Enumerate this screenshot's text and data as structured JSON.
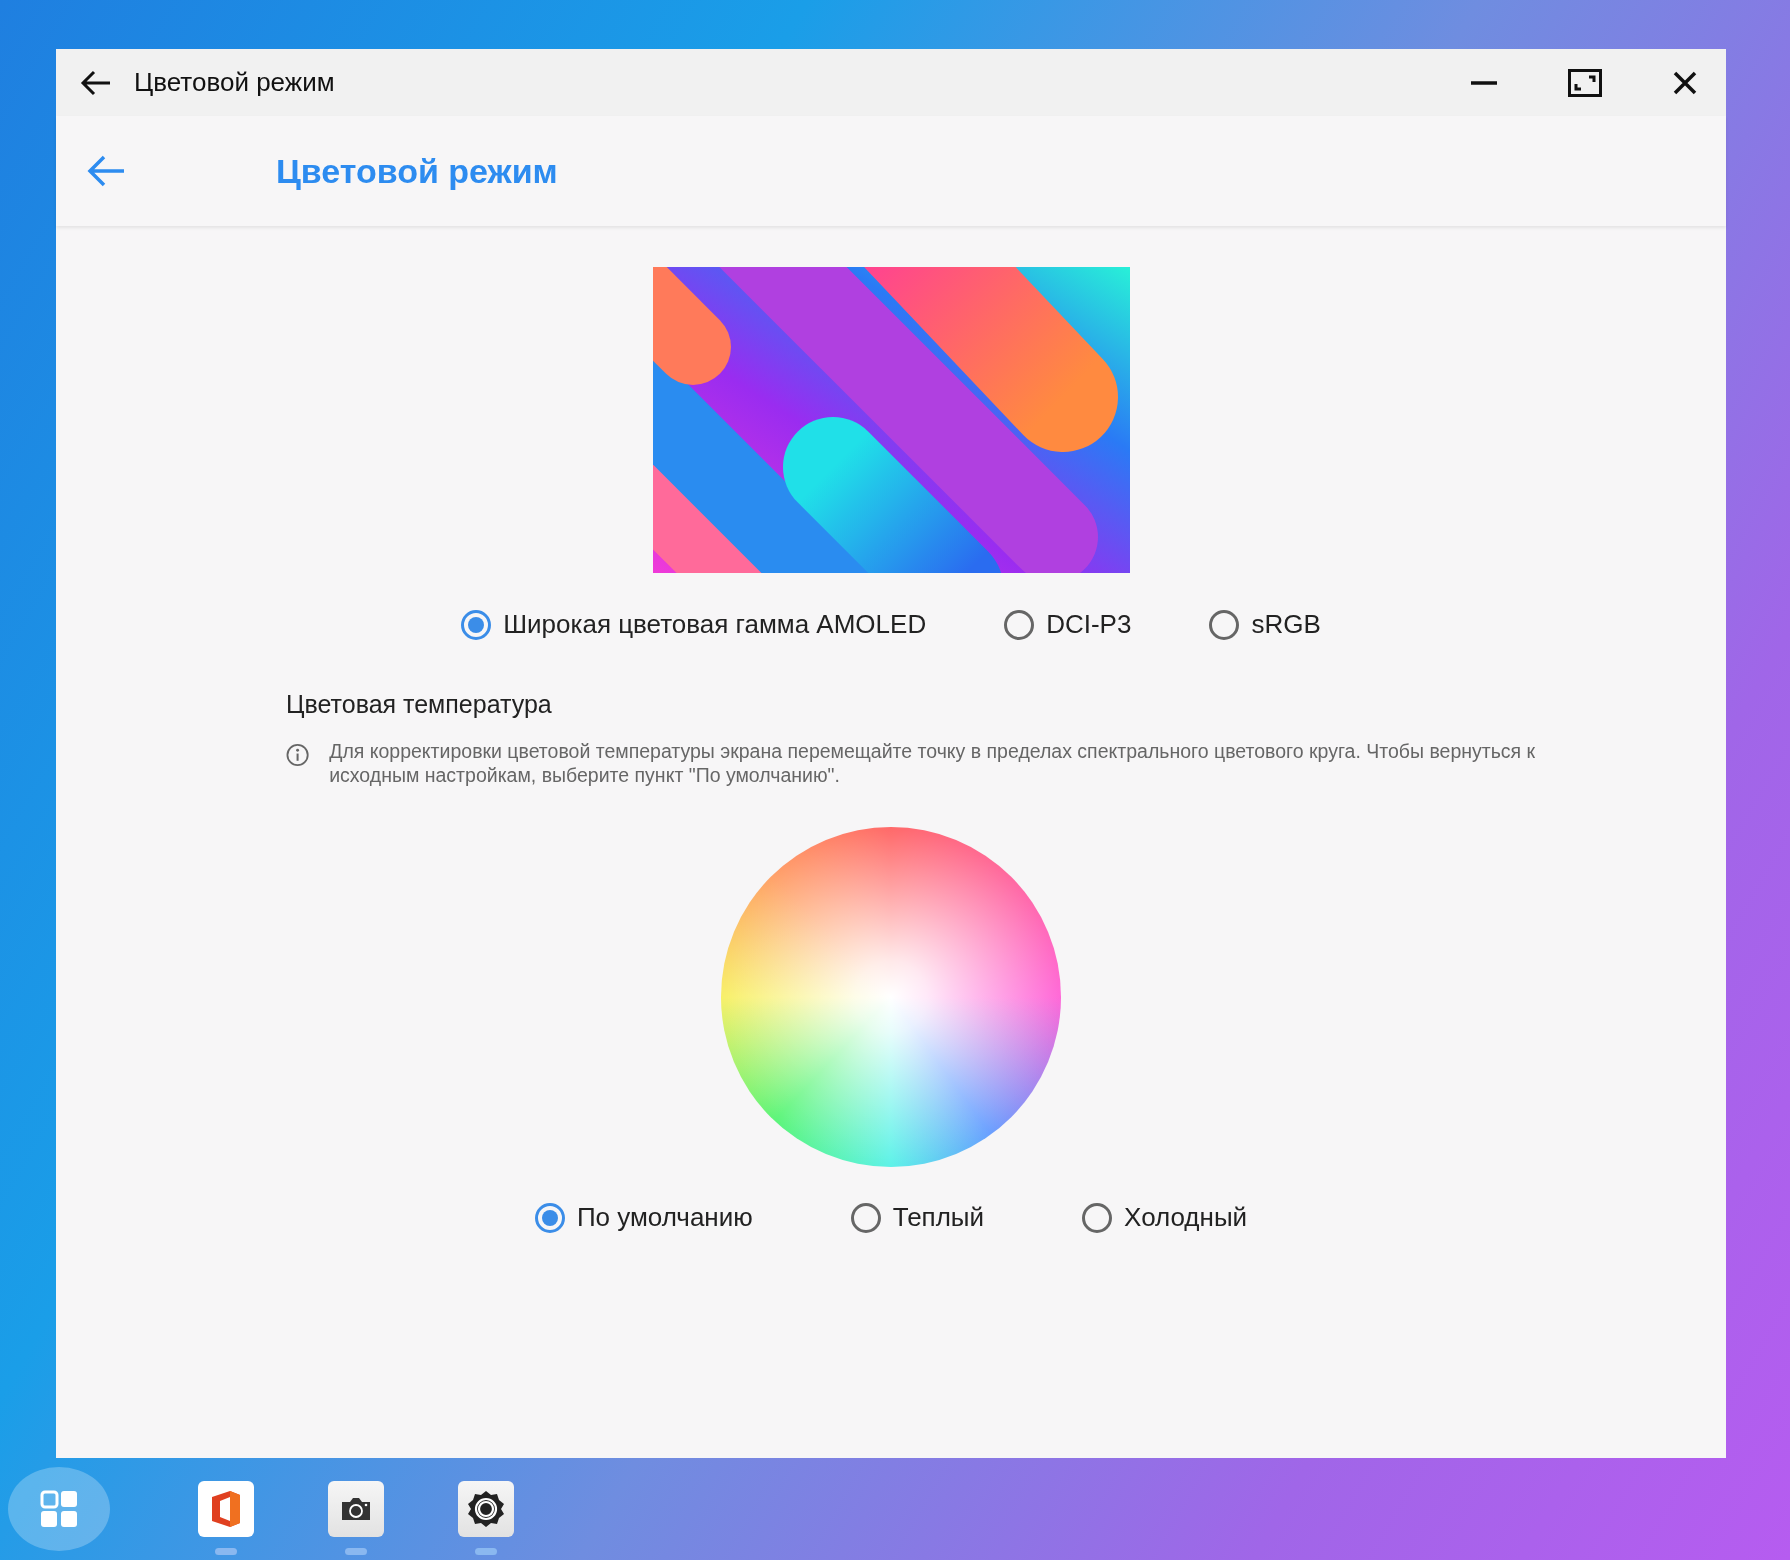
{
  "window": {
    "title": "Цветовой режим"
  },
  "header": {
    "title": "Цветовой режим"
  },
  "color_modes": [
    {
      "label": "Широкая цветовая гамма AMOLED",
      "selected": true
    },
    {
      "label": "DCI-P3",
      "selected": false
    },
    {
      "label": "sRGB",
      "selected": false
    }
  ],
  "temperature": {
    "title": "Цветовая температура",
    "hint": "Для корректировки цветовой температуры экрана перемещайте точку в пределах спектрального цветового круга. Чтобы вернуться к исходным настройкам, выберите пункт \"По умолчанию\".",
    "options": [
      {
        "label": "По умолчанию",
        "selected": true
      },
      {
        "label": "Теплый",
        "selected": false
      },
      {
        "label": "Холодный",
        "selected": false
      }
    ]
  }
}
